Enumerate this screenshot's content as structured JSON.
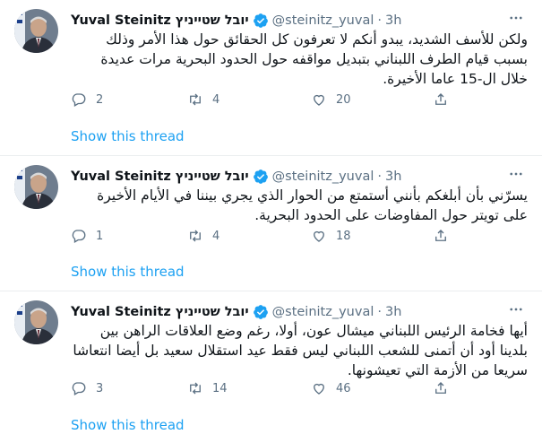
{
  "author": {
    "name": "Yuval Steinitz יובל שטייניץ",
    "handle": "@steinitz_yuval",
    "separator": "·",
    "time": "3h"
  },
  "colors": {
    "accent": "#1da1f2",
    "muted": "#5b7083",
    "text": "#0f1419",
    "separator": "#ebeef0"
  },
  "icons": {
    "reply": "reply-icon",
    "retweet": "retweet-icon",
    "like": "like-icon",
    "share": "share-icon",
    "more": "more-options-icon",
    "verified": "verified-badge-icon"
  },
  "tweets": [
    {
      "text": "ولكن للأسف الشديد، يبدو أنكم لا تعرفون كل الحقائق حول هذا الأمر وذلك بسبب قيام الطرف اللبناني بتبديل مواقفه حول الحدود البحرية مرات عديدة خلال ال-15 عاما الأخيرة.",
      "replies": "2",
      "retweets": "4",
      "likes": "20",
      "show_thread": "Show this thread"
    },
    {
      "text": "يسرّني بأن أبلغكم بأنني أستمتع من الحوار الذي يجري بيننا في الأيام الأخيرة على تويتر حول المفاوضات على الحدود البحرية.",
      "replies": "1",
      "retweets": "4",
      "likes": "18",
      "show_thread": "Show this thread"
    },
    {
      "text": "أيها فخامة الرئيس اللبناني ميشال عون، أولا، رغم وضع العلاقات الراهن بين بلدينا أود أن أتمنى للشعب اللبناني ليس فقط عيد استقلال سعيد بل أيضا انتعاشا سريعا من الأزمة التي تعيشونها.",
      "replies": "3",
      "retweets": "14",
      "likes": "46",
      "show_thread": "Show this thread"
    }
  ]
}
